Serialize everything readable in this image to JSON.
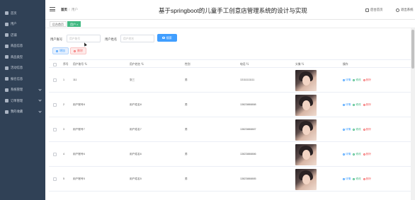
{
  "sidebar": {
    "items": [
      {
        "label": "首页",
        "icon": "home-icon",
        "expandable": false
      },
      {
        "label": "用户",
        "icon": "user-icon",
        "expandable": false
      },
      {
        "label": "店铺",
        "icon": "store-icon",
        "expandable": false
      },
      {
        "label": "商品信息",
        "icon": "goods-icon",
        "expandable": false
      },
      {
        "label": "商品类型",
        "icon": "category-icon",
        "expandable": false
      },
      {
        "label": "活动信息",
        "icon": "activity-icon",
        "expandable": false
      },
      {
        "label": "报名信息",
        "icon": "signup-icon",
        "expandable": false
      },
      {
        "label": "系统管理",
        "icon": "system-icon",
        "expandable": true
      },
      {
        "label": "订单管理",
        "icon": "order-icon",
        "expandable": true
      },
      {
        "label": "我的收藏",
        "icon": "favorite-icon",
        "expandable": true
      }
    ],
    "bg_color": "#304156"
  },
  "header": {
    "breadcrumb_home": "首页",
    "breadcrumb_sep": "/",
    "breadcrumb_current": "用户",
    "title": "基于springboot的儿童手工创意店管理系统的设计与实现",
    "backend_home": "后台首页",
    "logout": "退出系统"
  },
  "tags": {
    "home": "后台首页",
    "active": "用户 ×",
    "active_color": "#42b983"
  },
  "search": {
    "field1_label": "用户账号",
    "field1_placeholder": "用户账号",
    "field2_label": "用户姓名",
    "field2_placeholder": "用户姓名",
    "button": "搜索",
    "accent": "#409eff"
  },
  "actions": {
    "add": "增加",
    "delete": "删除"
  },
  "table": {
    "columns": [
      "",
      "序号",
      "用户账号 ⇅",
      "用户姓名 ⇅",
      "性别",
      "电话 ⇅",
      "头像 ⇅",
      "操作"
    ],
    "rows": [
      {
        "index": "1",
        "account": "111",
        "name": "张三",
        "gender": "男",
        "phone": "13111111111"
      },
      {
        "index": "2",
        "account": "用户账号8",
        "name": "用户姓名8",
        "gender": "男",
        "phone": "13823888888"
      },
      {
        "index": "3",
        "account": "用户账号7",
        "name": "用户姓名7",
        "gender": "男",
        "phone": "13823888887"
      },
      {
        "index": "4",
        "account": "用户账号6",
        "name": "用户姓名6",
        "gender": "男",
        "phone": "13823888886"
      },
      {
        "index": "5",
        "account": "用户账号5",
        "name": "用户姓名5",
        "gender": "男",
        "phone": "13823888885"
      }
    ],
    "ops": {
      "detail": "详情",
      "edit": "修改",
      "delete": "删除"
    }
  }
}
